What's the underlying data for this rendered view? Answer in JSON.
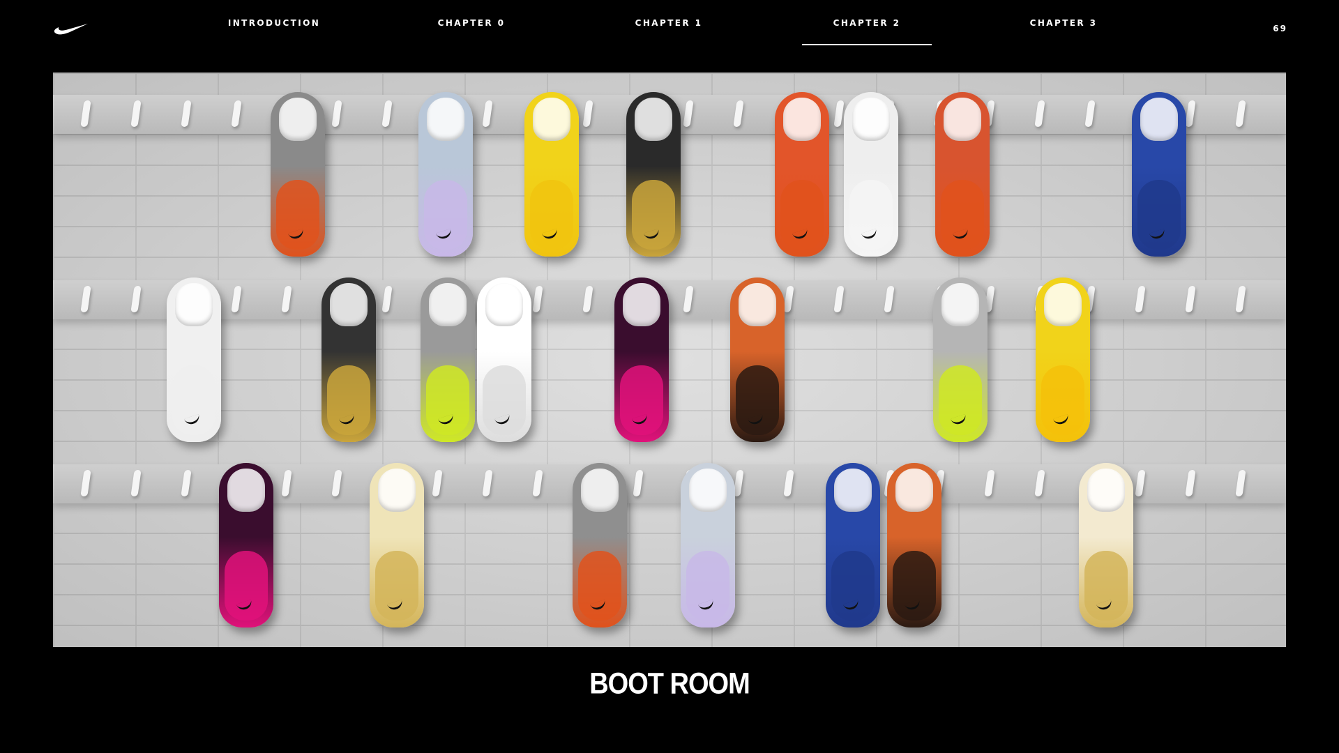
{
  "brand": {
    "logo_icon": "nike-swoosh-icon"
  },
  "nav": {
    "items": [
      {
        "label": "INTRODUCTION",
        "active": false
      },
      {
        "label": "CHAPTER 0",
        "active": false
      },
      {
        "label": "CHAPTER 1",
        "active": false
      },
      {
        "label": "CHAPTER 2",
        "active": true
      },
      {
        "label": "CHAPTER 3",
        "active": false
      }
    ],
    "page_number": "69"
  },
  "hero": {
    "image_subject": "boot-room-wall",
    "boots": [
      {
        "row": 1,
        "colors": [
          "#8a8a8a",
          "#e0521c"
        ]
      },
      {
        "row": 1,
        "colors": [
          "#b9c7d8",
          "#c8b8e8"
        ]
      },
      {
        "row": 1,
        "colors": [
          "#f1d31a",
          "#f1c40f"
        ]
      },
      {
        "row": 1,
        "colors": [
          "#2a2a2a",
          "#c9a43b"
        ]
      },
      {
        "row": 1,
        "colors": [
          "#e2552a",
          "#e0521c"
        ]
      },
      {
        "row": 1,
        "colors": [
          "#eeeeee",
          "#f5f5f5"
        ]
      },
      {
        "row": 1,
        "colors": [
          "#d8542f",
          "#e0521c"
        ]
      },
      {
        "row": 1,
        "colors": [
          "#2848a8",
          "#20398c"
        ]
      },
      {
        "row": 2,
        "colors": [
          "#f0f0f0",
          "#eeeeee"
        ]
      },
      {
        "row": 2,
        "colors": [
          "#333333",
          "#c9a43b"
        ]
      },
      {
        "row": 2,
        "colors": [
          "#9a9a9a",
          "#cfe825"
        ]
      },
      {
        "row": 2,
        "colors": [
          "#ffffff",
          "#dddddd"
        ]
      },
      {
        "row": 2,
        "colors": [
          "#3a0d2e",
          "#e0127a"
        ]
      },
      {
        "row": 2,
        "colors": [
          "#d8632a",
          "#2b1a12"
        ]
      },
      {
        "row": 2,
        "colors": [
          "#b5b5b5",
          "#cfe825"
        ]
      },
      {
        "row": 2,
        "colors": [
          "#f1d31a",
          "#f4c10a"
        ]
      },
      {
        "row": 3,
        "colors": [
          "#3a0d2e",
          "#e0127a"
        ]
      },
      {
        "row": 3,
        "colors": [
          "#efe4b8",
          "#d4b55a"
        ]
      },
      {
        "row": 3,
        "colors": [
          "#8f8f8f",
          "#e0521c"
        ]
      },
      {
        "row": 3,
        "colors": [
          "#c9d1dc",
          "#c8b8e8"
        ]
      },
      {
        "row": 3,
        "colors": [
          "#2848a8",
          "#20398c"
        ]
      },
      {
        "row": 3,
        "colors": [
          "#d8632a",
          "#2b1a12"
        ]
      },
      {
        "row": 3,
        "colors": [
          "#f3ead0",
          "#d4b55a"
        ]
      }
    ]
  },
  "section_title": "BOOT ROOM"
}
